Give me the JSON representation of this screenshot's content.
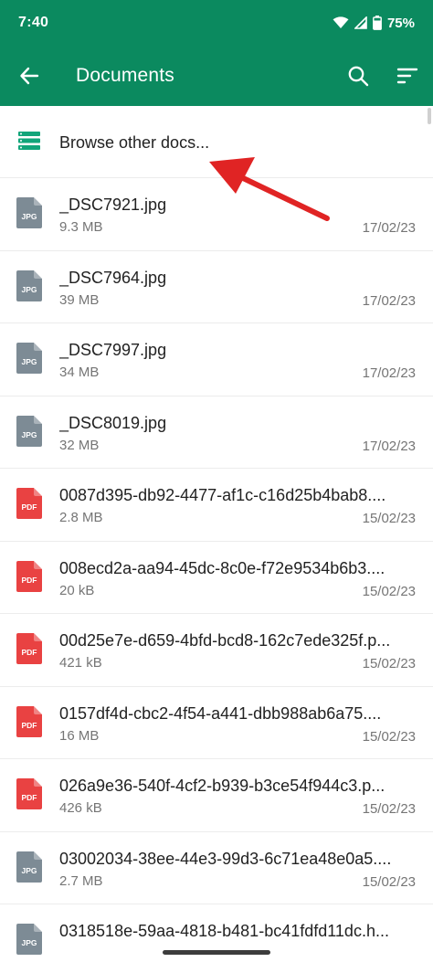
{
  "status": {
    "time": "7:40",
    "battery": "75%"
  },
  "appbar": {
    "title": "Documents"
  },
  "browse": {
    "label": "Browse other docs..."
  },
  "files": [
    {
      "name": "_DSC7921.jpg",
      "size": "9.3 MB",
      "date": "17/02/23",
      "type": "JPG"
    },
    {
      "name": "_DSC7964.jpg",
      "size": "39 MB",
      "date": "17/02/23",
      "type": "JPG"
    },
    {
      "name": "_DSC7997.jpg",
      "size": "34 MB",
      "date": "17/02/23",
      "type": "JPG"
    },
    {
      "name": "_DSC8019.jpg",
      "size": "32 MB",
      "date": "17/02/23",
      "type": "JPG"
    },
    {
      "name": "0087d395-db92-4477-af1c-c16d25b4bab8....",
      "size": "2.8 MB",
      "date": "15/02/23",
      "type": "PDF"
    },
    {
      "name": "008ecd2a-aa94-45dc-8c0e-f72e9534b6b3....",
      "size": "20 kB",
      "date": "15/02/23",
      "type": "PDF"
    },
    {
      "name": "00d25e7e-d659-4bfd-bcd8-162c7ede325f.p...",
      "size": "421 kB",
      "date": "15/02/23",
      "type": "PDF"
    },
    {
      "name": "0157df4d-cbc2-4f54-a441-dbb988ab6a75....",
      "size": "16 MB",
      "date": "15/02/23",
      "type": "PDF"
    },
    {
      "name": "026a9e36-540f-4cf2-b939-b3ce54f944c3.p...",
      "size": "426 kB",
      "date": "15/02/23",
      "type": "PDF"
    },
    {
      "name": "03002034-38ee-44e3-99d3-6c71ea48e0a5....",
      "size": "2.7 MB",
      "date": "15/02/23",
      "type": "JPG"
    },
    {
      "name": "0318518e-59aa-4818-b481-bc41fdfd11dc.h...",
      "size": "",
      "date": "",
      "type": "JPG"
    }
  ],
  "colors": {
    "appbar": "#0b8a5f",
    "jpg_icon": "#7d8b95",
    "pdf_icon": "#e94242",
    "browse_icon": "#12a57a",
    "annotation_arrow": "#e02424"
  }
}
